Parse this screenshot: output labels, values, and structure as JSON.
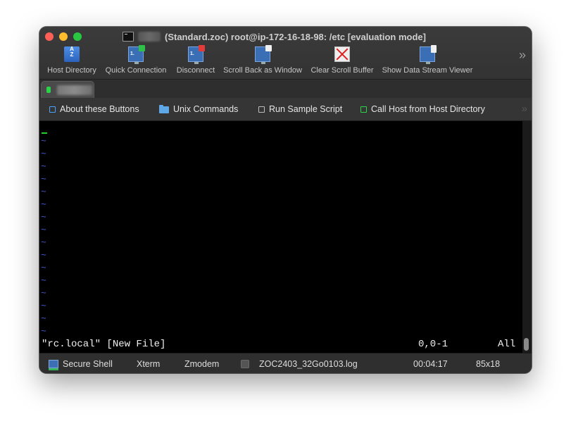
{
  "window": {
    "title": "(Standard.zoc) root@ip-172-16-18-98: /etc [evaluation mode]"
  },
  "toolbar": {
    "buttons": [
      {
        "label": "Host Directory",
        "icon": "address-book-icon"
      },
      {
        "label": "Quick Connection",
        "icon": "quick-connect-icon"
      },
      {
        "label": "Disconnect",
        "icon": "disconnect-icon"
      },
      {
        "label": "Scroll Back as Window",
        "icon": "scrollback-window-icon"
      },
      {
        "label": "Clear Scroll Buffer",
        "icon": "clear-buffer-icon"
      },
      {
        "label": "Show Data Stream Viewer",
        "icon": "data-stream-viewer-icon"
      }
    ],
    "overflow": "»"
  },
  "buttonbar": {
    "items": [
      {
        "label": "About these Buttons",
        "icon": "square-icon",
        "color": "#4aa3ff"
      },
      {
        "label": "Unix Commands",
        "icon": "folder-icon",
        "color": "#5fa8e8"
      },
      {
        "label": "Run Sample Script",
        "icon": "square-icon",
        "color": "#bdbdbd"
      },
      {
        "label": "Call Host from Host Directory",
        "icon": "square-icon",
        "color": "#2fd34a"
      }
    ],
    "overflow": "»"
  },
  "terminal": {
    "tilde": "~",
    "tilde_count": 16,
    "status_file": "\"rc.local\" [New File]",
    "status_pos": "0,0-1",
    "status_all": "All"
  },
  "statusbar": {
    "session": "Secure Shell",
    "emulation": "Xterm",
    "transfer": "Zmodem",
    "log_file": "ZOC2403_32Go0103.log",
    "elapsed": "00:04:17",
    "size": "85x18"
  },
  "colors": {
    "tilde": "#3a5fd6",
    "cursor": "#21d421",
    "tab_indicator": "#29d34a"
  }
}
